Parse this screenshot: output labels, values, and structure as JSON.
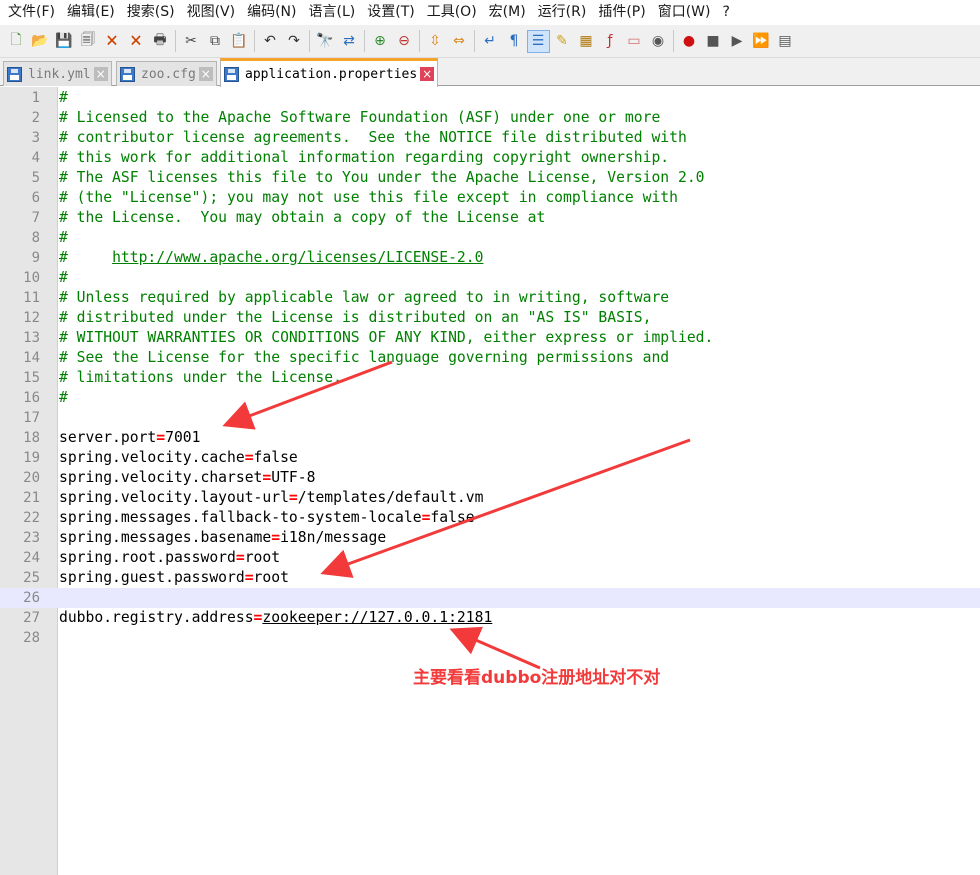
{
  "menu": [
    "文件(F)",
    "编辑(E)",
    "搜索(S)",
    "视图(V)",
    "编码(N)",
    "语言(L)",
    "设置(T)",
    "工具(O)",
    "宏(M)",
    "运行(R)",
    "插件(P)",
    "窗口(W)",
    "?"
  ],
  "toolbar": {
    "buttons": [
      {
        "icon": "new-file-icon",
        "glyph": "🗋",
        "color": "#4a8f3a"
      },
      {
        "icon": "open-folder-icon",
        "glyph": "📂",
        "color": "#d9a520"
      },
      {
        "icon": "save-icon",
        "glyph": "💾",
        "color": "#555555"
      },
      {
        "icon": "save-all-icon",
        "glyph": "🗐",
        "color": "#555555"
      },
      {
        "icon": "close-icon",
        "glyph": "🗙",
        "color": "#cc4400"
      },
      {
        "icon": "close-all-icon",
        "glyph": "🗙",
        "color": "#cc4400"
      },
      {
        "icon": "print-icon",
        "glyph": "🖶",
        "color": "#444444"
      },
      {
        "sep": true
      },
      {
        "icon": "cut-icon",
        "glyph": "✂",
        "color": "#444444"
      },
      {
        "icon": "copy-icon",
        "glyph": "⧉",
        "color": "#444444"
      },
      {
        "icon": "paste-icon",
        "glyph": "📋",
        "color": "#555555"
      },
      {
        "sep": true
      },
      {
        "icon": "undo-icon",
        "glyph": "↶",
        "color": "#333333"
      },
      {
        "icon": "redo-icon",
        "glyph": "↷",
        "color": "#333333"
      },
      {
        "sep": true
      },
      {
        "icon": "find-icon",
        "glyph": "🔭",
        "color": "#333333"
      },
      {
        "icon": "replace-icon",
        "glyph": "⇄",
        "color": "#2c6fbf"
      },
      {
        "sep": true
      },
      {
        "icon": "zoom-in-icon",
        "glyph": "⊕",
        "color": "#2e8b2e"
      },
      {
        "icon": "zoom-out-icon",
        "glyph": "⊖",
        "color": "#c03030"
      },
      {
        "sep": true
      },
      {
        "icon": "sync-vertical-icon",
        "glyph": "⇳",
        "color": "#d98a1a"
      },
      {
        "icon": "sync-horizontal-icon",
        "glyph": "⇔",
        "color": "#d98a1a"
      },
      {
        "sep": true
      },
      {
        "icon": "word-wrap-icon",
        "glyph": "↵",
        "color": "#2c6fbf"
      },
      {
        "icon": "show-all-chars-icon",
        "glyph": "¶",
        "color": "#2c6fbf"
      },
      {
        "icon": "indent-guide-icon",
        "glyph": "☰",
        "color": "#2c6fbf",
        "active": true
      },
      {
        "icon": "user-language-icon",
        "glyph": "✎",
        "color": "#c9a020"
      },
      {
        "icon": "doc-map-icon",
        "glyph": "▦",
        "color": "#b07a10"
      },
      {
        "icon": "function-list-icon",
        "glyph": "ƒ",
        "color": "#c03030"
      },
      {
        "icon": "folder-workspace-icon",
        "glyph": "▭",
        "color": "#d07070"
      },
      {
        "icon": "monitoring-icon",
        "glyph": "◉",
        "color": "#555555"
      },
      {
        "sep": true
      },
      {
        "icon": "macro-record-icon",
        "glyph": "●",
        "color": "#d01010"
      },
      {
        "icon": "macro-stop-icon",
        "glyph": "■",
        "color": "#555555"
      },
      {
        "icon": "macro-play-icon",
        "glyph": "▶",
        "color": "#555555"
      },
      {
        "icon": "macro-play-multiple-icon",
        "glyph": "⏩",
        "color": "#2c6fbf"
      },
      {
        "icon": "macro-save-icon",
        "glyph": "▤",
        "color": "#555555"
      }
    ]
  },
  "tabs": [
    {
      "label": "link.yml",
      "active": false
    },
    {
      "label": "zoo.cfg",
      "active": false
    },
    {
      "label": "application.properties",
      "active": true
    }
  ],
  "editor": {
    "current_line": 26,
    "lines": [
      {
        "n": "1",
        "parts": [
          {
            "t": "#",
            "c": "cmt"
          }
        ]
      },
      {
        "n": "2",
        "parts": [
          {
            "t": "# Licensed to the Apache Software Foundation (ASF) under one or more",
            "c": "cmt"
          }
        ]
      },
      {
        "n": "3",
        "parts": [
          {
            "t": "# contributor license agreements.  See the NOTICE file distributed with",
            "c": "cmt"
          }
        ]
      },
      {
        "n": "4",
        "parts": [
          {
            "t": "# this work for additional information regarding copyright ownership.",
            "c": "cmt"
          }
        ]
      },
      {
        "n": "5",
        "parts": [
          {
            "t": "# The ASF licenses this file to You under the Apache License, Version 2.0",
            "c": "cmt"
          }
        ]
      },
      {
        "n": "6",
        "parts": [
          {
            "t": "# (the \"License\"); you may not use this file except in compliance with",
            "c": "cmt"
          }
        ]
      },
      {
        "n": "7",
        "parts": [
          {
            "t": "# the License.  You may obtain a copy of the License at",
            "c": "cmt"
          }
        ]
      },
      {
        "n": "8",
        "parts": [
          {
            "t": "#",
            "c": "cmt"
          }
        ]
      },
      {
        "n": "9",
        "parts": [
          {
            "t": "#     ",
            "c": "cmt"
          },
          {
            "t": "http://www.apache.org/licenses/LICENSE-2.0",
            "c": "cmt url"
          }
        ]
      },
      {
        "n": "10",
        "parts": [
          {
            "t": "#",
            "c": "cmt"
          }
        ]
      },
      {
        "n": "11",
        "parts": [
          {
            "t": "# Unless required by applicable law or agreed to in writing, software",
            "c": "cmt"
          }
        ]
      },
      {
        "n": "12",
        "parts": [
          {
            "t": "# distributed under the License is distributed on an \"AS IS\" BASIS,",
            "c": "cmt"
          }
        ]
      },
      {
        "n": "13",
        "parts": [
          {
            "t": "# WITHOUT WARRANTIES OR CONDITIONS OF ANY KIND, either express or implied.",
            "c": "cmt"
          }
        ]
      },
      {
        "n": "14",
        "parts": [
          {
            "t": "# See the License for the specific language governing permissions and",
            "c": "cmt"
          }
        ]
      },
      {
        "n": "15",
        "parts": [
          {
            "t": "# limitations under the License.",
            "c": "cmt"
          }
        ]
      },
      {
        "n": "16",
        "parts": [
          {
            "t": "#",
            "c": "cmt"
          }
        ]
      },
      {
        "n": "17",
        "parts": []
      },
      {
        "n": "18",
        "parts": [
          {
            "t": "server.port",
            "c": ""
          },
          {
            "t": "=",
            "c": "eq"
          },
          {
            "t": "7001",
            "c": ""
          }
        ]
      },
      {
        "n": "19",
        "parts": [
          {
            "t": "spring.velocity.cache",
            "c": ""
          },
          {
            "t": "=",
            "c": "eq"
          },
          {
            "t": "false",
            "c": ""
          }
        ]
      },
      {
        "n": "20",
        "parts": [
          {
            "t": "spring.velocity.charset",
            "c": ""
          },
          {
            "t": "=",
            "c": "eq"
          },
          {
            "t": "UTF-8",
            "c": ""
          }
        ]
      },
      {
        "n": "21",
        "parts": [
          {
            "t": "spring.velocity.layout-url",
            "c": ""
          },
          {
            "t": "=",
            "c": "eq"
          },
          {
            "t": "/templates/default.vm",
            "c": ""
          }
        ]
      },
      {
        "n": "22",
        "parts": [
          {
            "t": "spring.messages.fallback-to-system-locale",
            "c": ""
          },
          {
            "t": "=",
            "c": "eq"
          },
          {
            "t": "false",
            "c": ""
          }
        ]
      },
      {
        "n": "23",
        "parts": [
          {
            "t": "spring.messages.basename",
            "c": ""
          },
          {
            "t": "=",
            "c": "eq"
          },
          {
            "t": "i18n/message",
            "c": ""
          }
        ]
      },
      {
        "n": "24",
        "parts": [
          {
            "t": "spring.root.password",
            "c": ""
          },
          {
            "t": "=",
            "c": "eq"
          },
          {
            "t": "root",
            "c": ""
          }
        ]
      },
      {
        "n": "25",
        "parts": [
          {
            "t": "spring.guest.password",
            "c": ""
          },
          {
            "t": "=",
            "c": "eq"
          },
          {
            "t": "root",
            "c": ""
          }
        ]
      },
      {
        "n": "26",
        "parts": []
      },
      {
        "n": "27",
        "parts": [
          {
            "t": "dubbo.registry.address",
            "c": ""
          },
          {
            "t": "=",
            "c": "eq"
          },
          {
            "t": "zookeeper://127.0.0.1:2181",
            "c": "uline"
          }
        ]
      },
      {
        "n": "28",
        "parts": []
      }
    ]
  },
  "annotation": {
    "text": "主要看看dubbo注册地址对不对",
    "color": "#f23a3a"
  }
}
